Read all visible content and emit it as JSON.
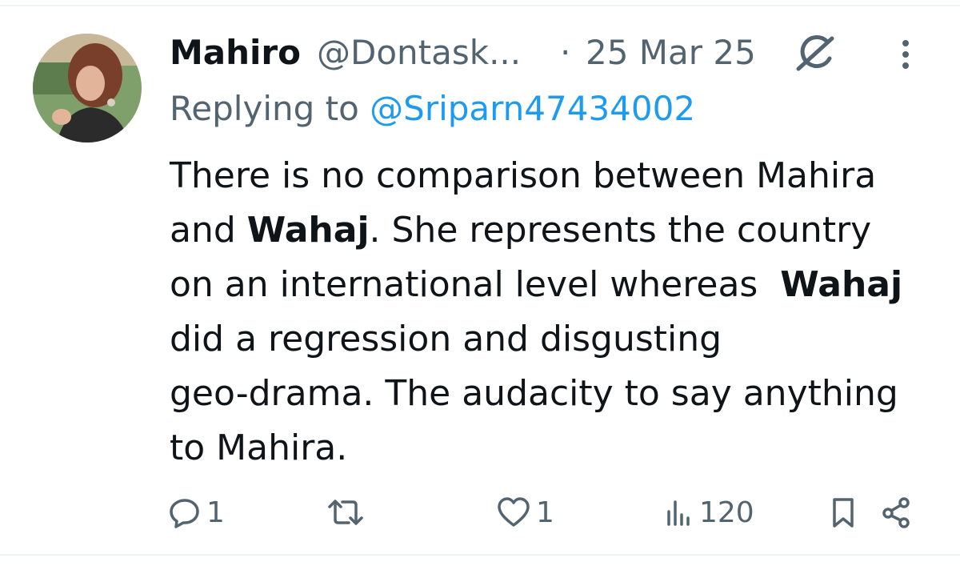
{
  "tweet": {
    "author_name": "Mahiro",
    "handle": "@Dontask...",
    "separator": "·",
    "date": "25 Mar 25",
    "replying_prefix": "Replying to",
    "replying_to": "@Sriparn47434002",
    "text_segments": {
      "l1": "There is no comparison between Mahira",
      "l2a": "and ",
      "l2b": "Wahaj",
      "l2c": ". She represents the country",
      "l3a": "on an international level whereas  ",
      "l3b": "Wahaj",
      "l4": "did a regression and disgusting",
      "l5": "geo-drama. The audacity to say anything",
      "l6": "to Mahira."
    }
  },
  "actions": {
    "reply_count": "1",
    "retweet_count": "",
    "like_count": "1",
    "views_count": "120"
  },
  "icons": {
    "grok": "grok-icon",
    "more": "more-vertical-icon",
    "reply": "reply-icon",
    "retweet": "retweet-icon",
    "like": "heart-icon",
    "views": "views-chart-icon",
    "bookmark": "bookmark-icon",
    "share": "share-icon"
  },
  "colors": {
    "text": "#0f1419",
    "muted": "#536471",
    "link": "#1d9bf0",
    "divider": "#eff3f4"
  }
}
